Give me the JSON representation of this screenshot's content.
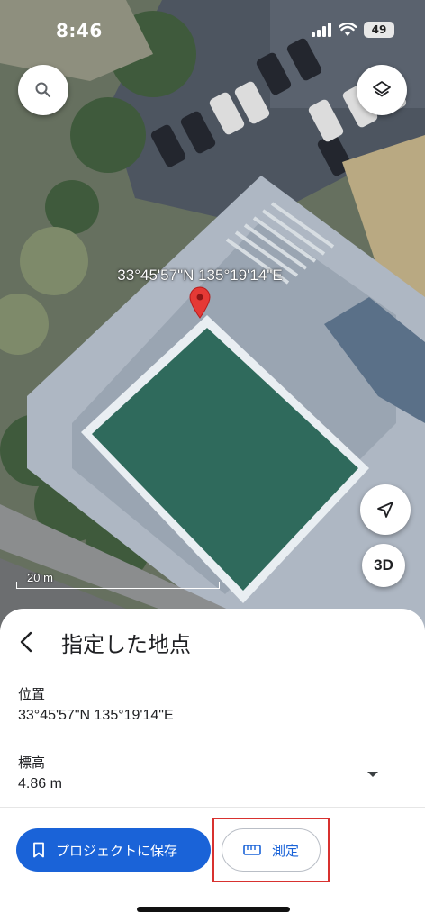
{
  "status_bar": {
    "time": "8:46",
    "battery": "49"
  },
  "map": {
    "coordinate_label": "33°45'57\"N 135°19'14\"E",
    "scale_label": "20 m",
    "btn_3d_label": "3D",
    "pin_color": "#e53935"
  },
  "sheet": {
    "title": "指定した地点",
    "position": {
      "label": "位置",
      "value": "33°45'57\"N 135°19'14\"E"
    },
    "elevation": {
      "label": "標高",
      "value": "4.86 m"
    },
    "save_button_label": "プロジェクトに保存",
    "measure_button_label": "測定"
  },
  "colors": {
    "accent": "#1a63d8",
    "highlight": "#d8312f"
  },
  "icons": {
    "search": "search-icon",
    "layers": "layers-icon",
    "navigation": "navigation-arrow-icon",
    "back": "chevron-left-icon",
    "expand": "chevron-down-icon",
    "bookmark": "bookmark-icon",
    "ruler": "ruler-icon"
  }
}
